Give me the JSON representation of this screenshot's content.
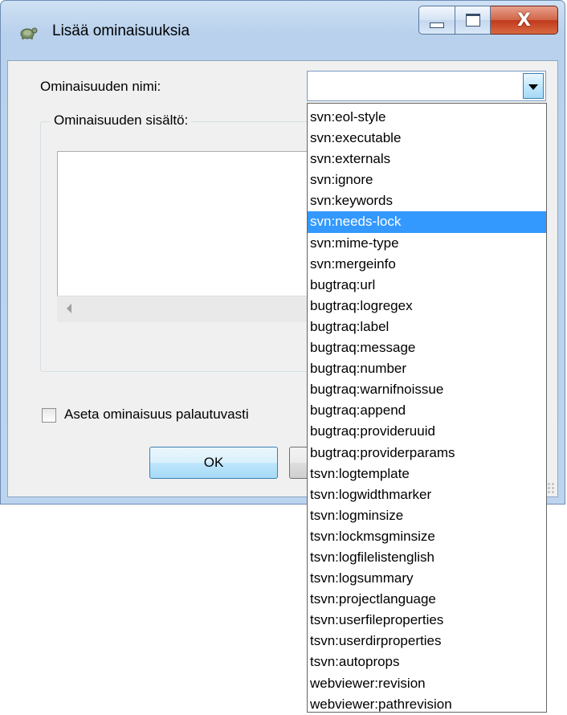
{
  "window": {
    "title": "Lisää ominaisuuksia",
    "minimize_glyph": "minimize",
    "maximize_glyph": "maximize",
    "close_glyph": "X"
  },
  "form": {
    "name_label": "Ominaisuuden nimi:",
    "name_value": "",
    "content_group_label": "Ominaisuuden sisältö:",
    "content_value": "",
    "recursive_label": "Aseta ominaisuus palautuvasti",
    "recursive_checked": false,
    "ok_label": "OK"
  },
  "dropdown": {
    "selected": "svn:needs-lock",
    "items": [
      "svn:eol-style",
      "svn:executable",
      "svn:externals",
      "svn:ignore",
      "svn:keywords",
      "svn:needs-lock",
      "svn:mime-type",
      "svn:mergeinfo",
      "bugtraq:url",
      "bugtraq:logregex",
      "bugtraq:label",
      "bugtraq:message",
      "bugtraq:number",
      "bugtraq:warnifnoissue",
      "bugtraq:append",
      "bugtraq:provideruuid",
      "bugtraq:providerparams",
      "tsvn:logtemplate",
      "tsvn:logwidthmarker",
      "tsvn:logminsize",
      "tsvn:lockmsgminsize",
      "tsvn:logfilelistenglish",
      "tsvn:logsummary",
      "tsvn:projectlanguage",
      "tsvn:userfileproperties",
      "tsvn:userdirproperties",
      "tsvn:autoprops",
      "webviewer:revision",
      "webviewer:pathrevision"
    ]
  },
  "colors": {
    "selection": "#3399ff",
    "dialog_bg": "#f0f0f0",
    "frame": "#bcd4ee"
  }
}
